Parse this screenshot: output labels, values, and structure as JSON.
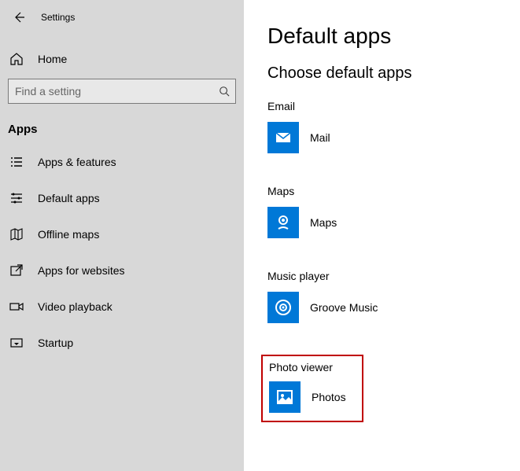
{
  "window": {
    "title": "Settings"
  },
  "sidebar": {
    "home_label": "Home",
    "search_placeholder": "Find a setting",
    "section_heading": "Apps",
    "items": [
      {
        "label": "Apps & features"
      },
      {
        "label": "Default apps"
      },
      {
        "label": "Offline maps"
      },
      {
        "label": "Apps for websites"
      },
      {
        "label": "Video playback"
      },
      {
        "label": "Startup"
      }
    ]
  },
  "main": {
    "title": "Default apps",
    "subtitle": "Choose default apps",
    "categories": [
      {
        "label": "Email",
        "app_name": "Mail"
      },
      {
        "label": "Maps",
        "app_name": "Maps"
      },
      {
        "label": "Music player",
        "app_name": "Groove Music"
      },
      {
        "label": "Photo viewer",
        "app_name": "Photos"
      }
    ]
  }
}
